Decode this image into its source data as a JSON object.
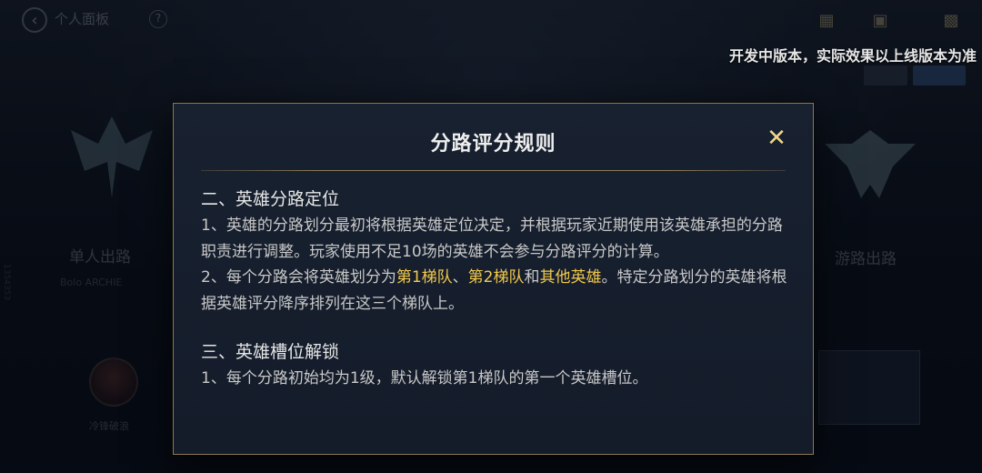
{
  "header": {
    "title": "个人面板",
    "help_symbol": "?",
    "dev_notice": "开发中版本，实际效果以上线版本为准"
  },
  "background": {
    "left_lane": {
      "name": "单人出路",
      "sub": "Bolo   ARCHIE"
    },
    "right_lane": {
      "name": "游路出路"
    },
    "avatar_name": "冷锋破浪",
    "vertical_text": "1354353"
  },
  "modal": {
    "title": "分路评分规则",
    "close_symbol": "✕",
    "sections": [
      {
        "heading": "二、英雄分路定位",
        "p1": " 1、英雄的分路划分最初将根据英雄定位决定，并根据玩家近期使用该英雄承担的分路职责进行调整。玩家使用不足10场的英雄不会参与分路评分的计算。",
        "p2_prefix": "2、每个分路会将英雄划分为",
        "tier1": "第1梯队",
        "sep": "、",
        "tier2": "第2梯队",
        "and": "和",
        "other": "其他英雄",
        "p2_suffix": "。特定分路划分的英雄将根据英雄评分降序排列在这三个梯队上。"
      },
      {
        "heading": "三、英雄槽位解锁",
        "p1": " 1、每个分路初始均为1级，默认解锁第1梯队的第一个英雄槽位。"
      }
    ]
  },
  "colors": {
    "accent_gold": "#f2c94c",
    "border_gold": "#8c7a54",
    "close_gold": "#f0d68a"
  }
}
